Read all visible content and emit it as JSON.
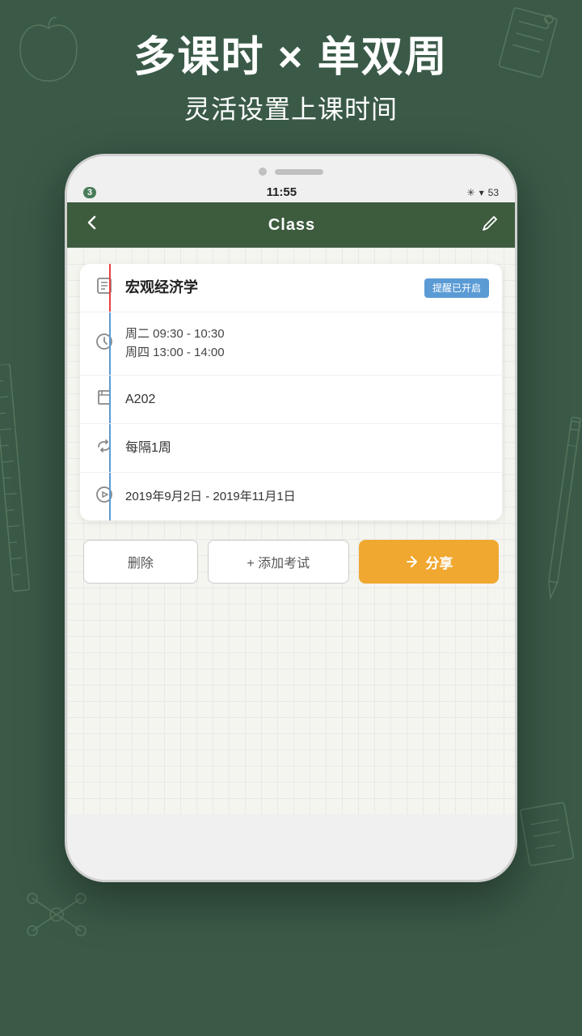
{
  "background": {
    "color": "#3a5a47"
  },
  "header": {
    "main_title": "多课时 × 单双周",
    "sub_title": "灵活设置上课时间"
  },
  "status_bar": {
    "left_indicator": "3",
    "time": "11:55",
    "bluetooth": "bluetooth",
    "wifi": "wifi",
    "battery": "53"
  },
  "app_bar": {
    "title": "Class",
    "back_icon": "‹",
    "edit_icon": "✏"
  },
  "class_info": {
    "name": "宏观经济学",
    "reminder_badge": "提醒已开启",
    "schedule_line1": "周二 09:30 - 10:30",
    "schedule_line2": "周四 13:00 - 14:00",
    "room": "A202",
    "interval": "每隔1周",
    "date_range": "2019年9月2日 - 2019年11月1日"
  },
  "buttons": {
    "delete": "删除",
    "add_exam": "+ 添加考试",
    "share": "分享"
  }
}
